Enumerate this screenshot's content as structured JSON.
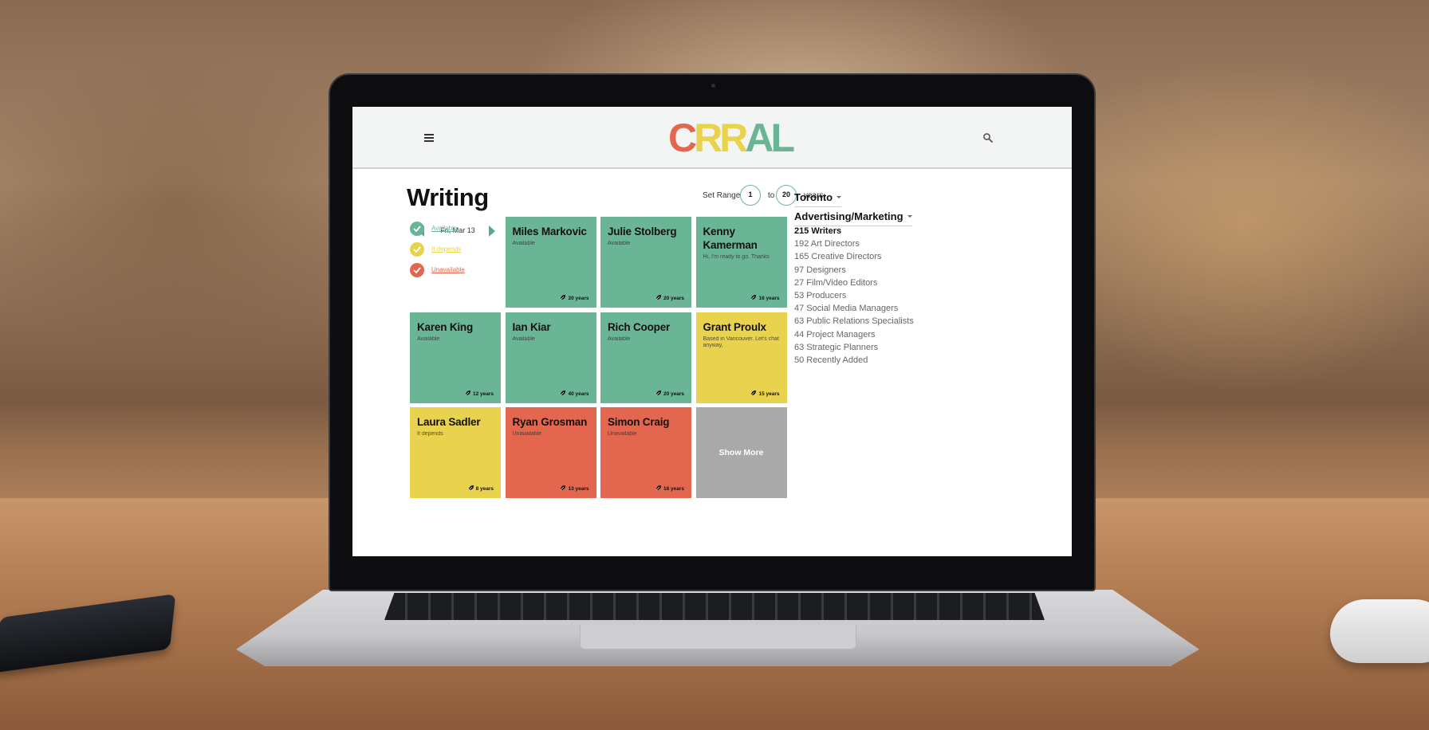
{
  "app": {
    "logo": {
      "letters": [
        {
          "char": "C",
          "color": "#e2674e"
        },
        {
          "char": "R",
          "color": "#e8d24e"
        },
        {
          "char": "R",
          "color": "#e8d24e"
        },
        {
          "char": "A",
          "color": "#6bb597"
        },
        {
          "char": "L",
          "color": "#6bb597"
        }
      ]
    },
    "menu_icon": "hamburger-icon",
    "search_icon": "search-icon"
  },
  "page": {
    "title": "Writing",
    "range": {
      "label": "Set Range:",
      "min": "1",
      "to": "to",
      "max": "20",
      "unit": "years"
    }
  },
  "date_nav": {
    "date": "Fri, Mar 13"
  },
  "legend": [
    {
      "label": "Available",
      "color": "#6bb597"
    },
    {
      "label": "It depends",
      "color": "#e8d24e"
    },
    {
      "label": "Unavailable",
      "color": "#e2674e"
    }
  ],
  "colors": {
    "available": "#6bb597",
    "depends": "#e8d24e",
    "unavailable": "#e2674e",
    "more": "#a9a9a9"
  },
  "cards": [
    {
      "name": "Miles Markovic",
      "status": "Available",
      "years": "20 years",
      "state": "available"
    },
    {
      "name": "Julie Stolberg",
      "status": "Available",
      "years": "20 years",
      "state": "available"
    },
    {
      "name": "Kenny Kamerman",
      "status": "Hi, I'm ready to go. Thanks",
      "years": "16 years",
      "state": "available"
    },
    {
      "name": "Karen King",
      "status": "Available",
      "years": "12 years",
      "state": "available"
    },
    {
      "name": "Ian Kiar",
      "status": "Available",
      "years": "40 years",
      "state": "available"
    },
    {
      "name": "Rich Cooper",
      "status": "Available",
      "years": "20 years",
      "state": "available"
    },
    {
      "name": "Grant Proulx",
      "status": "Based in Vancouver. Let's chat anyway,",
      "years": "15 years",
      "state": "depends"
    },
    {
      "name": "Laura Sadler",
      "status": "It depends",
      "years": "8 years",
      "state": "depends"
    },
    {
      "name": "Ryan Grosman",
      "status": "Unavailable",
      "years": "13 years",
      "state": "unavailable"
    },
    {
      "name": "Simon Craig",
      "status": "Unavailable",
      "years": "16 years",
      "state": "unavailable"
    }
  ],
  "show_more": {
    "label": "Show More"
  },
  "filters": {
    "city": "Toronto",
    "industry": "Advertising/Marketing",
    "categories": [
      {
        "label": "215 Writers",
        "active": true
      },
      {
        "label": "192 Art Directors",
        "active": false
      },
      {
        "label": "165 Creative Directors",
        "active": false
      },
      {
        "label": "97 Designers",
        "active": false
      },
      {
        "label": "27 Film/Video Editors",
        "active": false
      },
      {
        "label": "53 Producers",
        "active": false
      },
      {
        "label": "47 Social Media Managers",
        "active": false
      },
      {
        "label": "63 Public Relations Specialists",
        "active": false
      },
      {
        "label": "44 Project Managers",
        "active": false
      },
      {
        "label": "63 Strategic Planners",
        "active": false
      },
      {
        "label": "50 Recently Added",
        "active": false
      }
    ]
  }
}
